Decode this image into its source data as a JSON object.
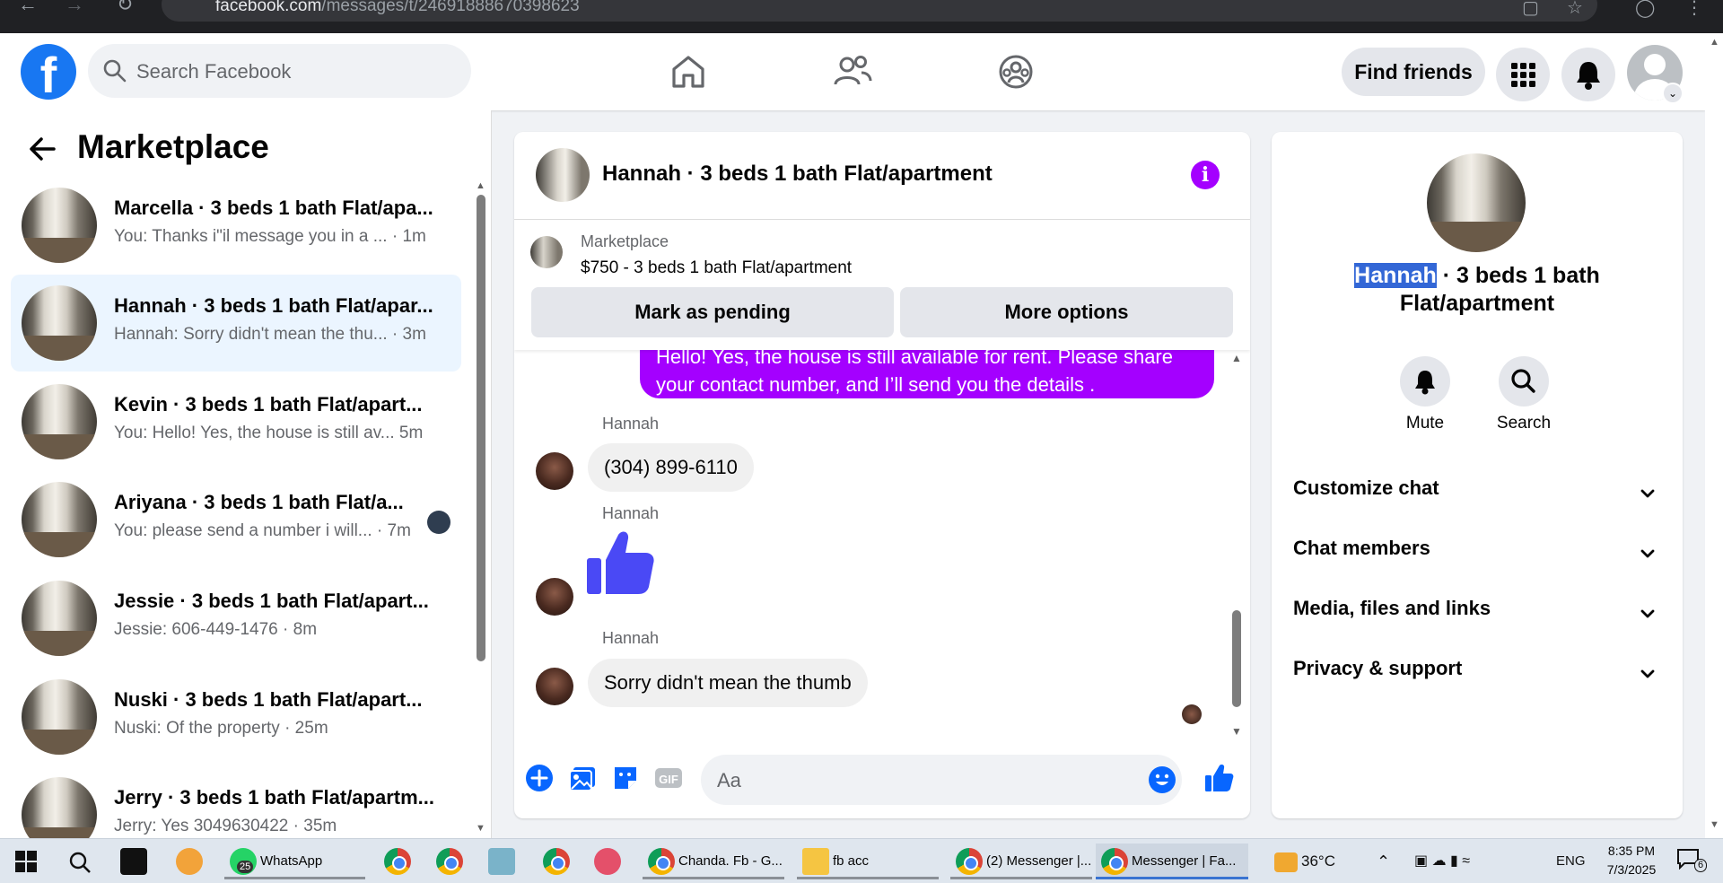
{
  "browser": {
    "url_host": "facebook.com",
    "url_path": "/messages/t/24691888670398623"
  },
  "header": {
    "search_placeholder": "Search Facebook",
    "find_friends_label": "Find friends"
  },
  "sidebar": {
    "title": "Marketplace",
    "conversations": [
      {
        "name": "Marcella · 3 beds 1 bath Flat/apa...",
        "preview": "You: Thanks i\"il message you in a ... · 1m",
        "active": false
      },
      {
        "name": "Hannah · 3 beds 1 bath Flat/apar...",
        "preview": "Hannah: Sorry didn't mean the thu... · 3m",
        "active": true
      },
      {
        "name": "Kevin · 3 beds 1 bath Flat/apart...",
        "preview": "You: Hello! Yes, the house is still av... 5m",
        "active": false
      },
      {
        "name": "Ariyana · 3 beds 1 bath Flat/a...",
        "preview": "You: please send a number i will... · 7m",
        "active": false
      },
      {
        "name": "Jessie · 3 beds 1 bath Flat/apart...",
        "preview": "Jessie: 606-449-1476 · 8m",
        "active": false
      },
      {
        "name": "Nuski · 3 beds 1 bath Flat/apart...",
        "preview": "Nuski: Of the property · 25m",
        "active": false
      },
      {
        "name": "Jerry · 3 beds 1 bath Flat/apartm...",
        "preview": "Jerry: Yes 3049630422 · 35m",
        "active": false
      }
    ]
  },
  "chat": {
    "title": "Hannah · 3 beds 1 bath Flat/apartment",
    "marketplace_label": "Marketplace",
    "listing": "$750 - 3 beds 1 bath Flat/apartment",
    "mark_pending_label": "Mark as pending",
    "more_options_label": "More options",
    "outgoing_message": "Hello! Yes, the house is still available for rent. Please share your contact number, and I’ll send you the details .",
    "messages": [
      {
        "sender": "Hannah",
        "text": "(304) 899-6110"
      },
      {
        "sender": "Hannah",
        "text": ""
      },
      {
        "sender": "Hannah",
        "text": "Sorry didn't mean the thumb"
      }
    ],
    "composer_placeholder": "Aa"
  },
  "details": {
    "name_selected": "Hannah",
    "name_rest": " · 3 beds 1 bath Flat/apartment",
    "mute_label": "Mute",
    "search_label": "Search",
    "sections": [
      "Customize chat",
      "Chat members",
      "Media, files and links",
      "Privacy & support"
    ]
  },
  "taskbar": {
    "whatsapp_label": "WhatsApp",
    "whatsapp_badge": "25",
    "app1_label": "Chanda. Fb - G...",
    "app2_label": "fb acc",
    "app3_label": "(2) Messenger |...",
    "app4_label": "Messenger | Fa...",
    "weather": "36°C",
    "lang": "ENG",
    "time": "8:35 PM",
    "date": "7/3/2025",
    "notif_count": "6"
  },
  "colors": {
    "fb_blue": "#1877f2",
    "messenger_purple": "#a400ff",
    "active_conv_bg": "#ebf5ff"
  }
}
